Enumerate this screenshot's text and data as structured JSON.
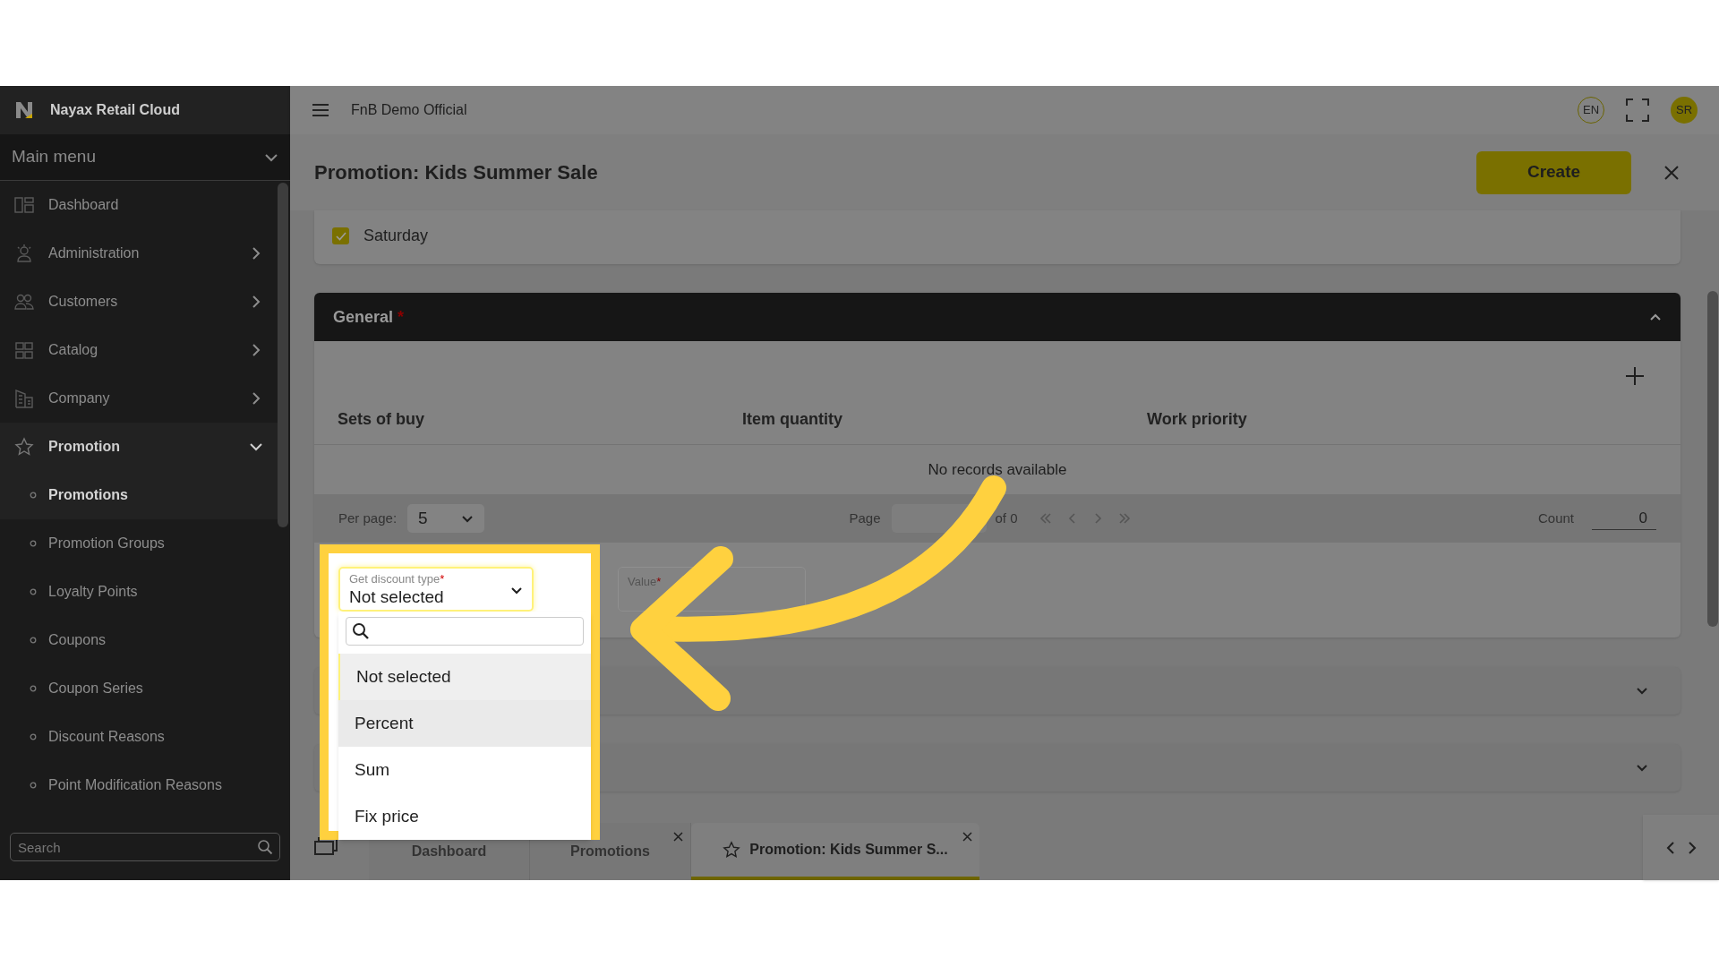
{
  "brand": "Nayax Retail Cloud",
  "sidebar": {
    "menu_title": "Main menu",
    "items": [
      {
        "label": "Dashboard",
        "expandable": false,
        "expanded": false
      },
      {
        "label": "Administration",
        "expandable": true,
        "expanded": false
      },
      {
        "label": "Customers",
        "expandable": true,
        "expanded": false
      },
      {
        "label": "Catalog",
        "expandable": true,
        "expanded": false
      },
      {
        "label": "Company",
        "expandable": true,
        "expanded": false
      },
      {
        "label": "Promotion",
        "expandable": true,
        "expanded": true,
        "children": [
          {
            "label": "Promotions",
            "selected": true
          },
          {
            "label": "Promotion Groups",
            "selected": false
          },
          {
            "label": "Loyalty Points",
            "selected": false
          },
          {
            "label": "Coupons",
            "selected": false
          },
          {
            "label": "Coupon Series",
            "selected": false
          },
          {
            "label": "Discount Reasons",
            "selected": false
          },
          {
            "label": "Point Modification Reasons",
            "selected": false
          }
        ]
      }
    ],
    "search": {
      "placeholder": "Search"
    }
  },
  "topbar": {
    "organization": "FnB Demo Official",
    "language": "EN",
    "avatar": "SR"
  },
  "page": {
    "title": "Promotion: Kids Summer Sale",
    "create_button": "Create"
  },
  "days": [
    {
      "label": "Saturday",
      "checked": true
    }
  ],
  "general": {
    "title": "General",
    "required_mark": "*",
    "expanded": true,
    "columns": [
      "Sets of buy",
      "Item quantity",
      "Work priority"
    ],
    "empty_text": "No records available",
    "pagination": {
      "per_page_label": "Per page:",
      "per_page": "5",
      "page_label": "Page",
      "of_label": "of 0",
      "count_label": "Count",
      "count": "0"
    }
  },
  "discount_type": {
    "label": "Get discount type",
    "required_mark": "*",
    "value": "Not selected",
    "open": true,
    "options": [
      {
        "label": "Not selected",
        "selected": true,
        "hovered": false
      },
      {
        "label": "Percent",
        "selected": false,
        "hovered": true
      },
      {
        "label": "Sum",
        "selected": false,
        "hovered": false
      },
      {
        "label": "Fix price",
        "selected": false,
        "hovered": false
      }
    ]
  },
  "value_field": {
    "label": "Value",
    "required_mark": "*"
  },
  "collapsed_sections": [
    {
      "expanded": false
    },
    {
      "expanded": false
    }
  ],
  "bottom_tabs": [
    {
      "label": "Dashboard",
      "selected": false,
      "closable": false
    },
    {
      "label": "Promotions",
      "selected": false,
      "closable": true
    },
    {
      "label": "Promotion: Kids Summer S...",
      "selected": true,
      "closable": true
    }
  ]
}
